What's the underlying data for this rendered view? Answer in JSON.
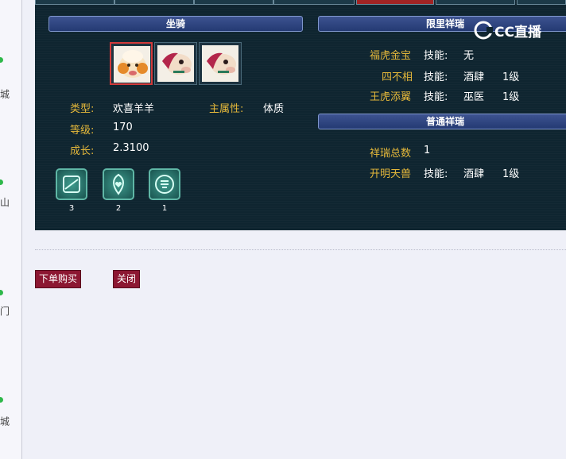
{
  "sidebar": {
    "items": [
      {
        "label": "城"
      },
      {
        "label": "山"
      },
      {
        "label": "门"
      },
      {
        "label": "城"
      }
    ]
  },
  "mount_section": {
    "title": "坐骑",
    "mounts": [
      {
        "name": "欢喜羊羊",
        "icon": "sheep-mount-icon",
        "selected": true
      },
      {
        "name": "horse-mount",
        "icon": "horse-mount-icon",
        "selected": false
      },
      {
        "name": "horse-mount",
        "icon": "horse-mount-icon",
        "selected": false
      }
    ],
    "type_label": "类型:",
    "type_value": "欢喜羊羊",
    "attr_label": "主属性:",
    "attr_value": "体质",
    "level_label": "等级:",
    "level_value": "170",
    "growth_label": "成长:",
    "growth_value": "2.3100",
    "skills": [
      {
        "icon": "skill-scroll-icon",
        "count": "3"
      },
      {
        "icon": "skill-heart-icon",
        "count": "2"
      },
      {
        "icon": "skill-seal-icon",
        "count": "1"
      }
    ]
  },
  "limited_section": {
    "title": "限里祥瑞",
    "rows": [
      {
        "name": "福虎金宝",
        "skill_label": "技能:",
        "skill": "无",
        "level": ""
      },
      {
        "name": "四不相",
        "skill_label": "技能:",
        "skill": "酒肆",
        "level": "1级"
      },
      {
        "name": "王虎添翼",
        "skill_label": "技能:",
        "skill": "巫医",
        "level": "1级"
      }
    ]
  },
  "normal_section": {
    "title": "普通祥瑞",
    "total_label": "祥瑞总数",
    "total_value": "1",
    "rows": [
      {
        "name": "开明天兽",
        "skill_label": "技能:",
        "skill": "酒肆",
        "level": "1级"
      }
    ]
  },
  "buttons": {
    "order_label": "下单购买",
    "close_label": "关闭"
  },
  "watermark": {
    "text": "CC直播"
  },
  "colors": {
    "panel_bg": "#0f2530",
    "label_gold": "#e5b83a",
    "value_white": "#ffffff",
    "button_bg": "#8c1732",
    "section_bar": "#2e4580"
  }
}
